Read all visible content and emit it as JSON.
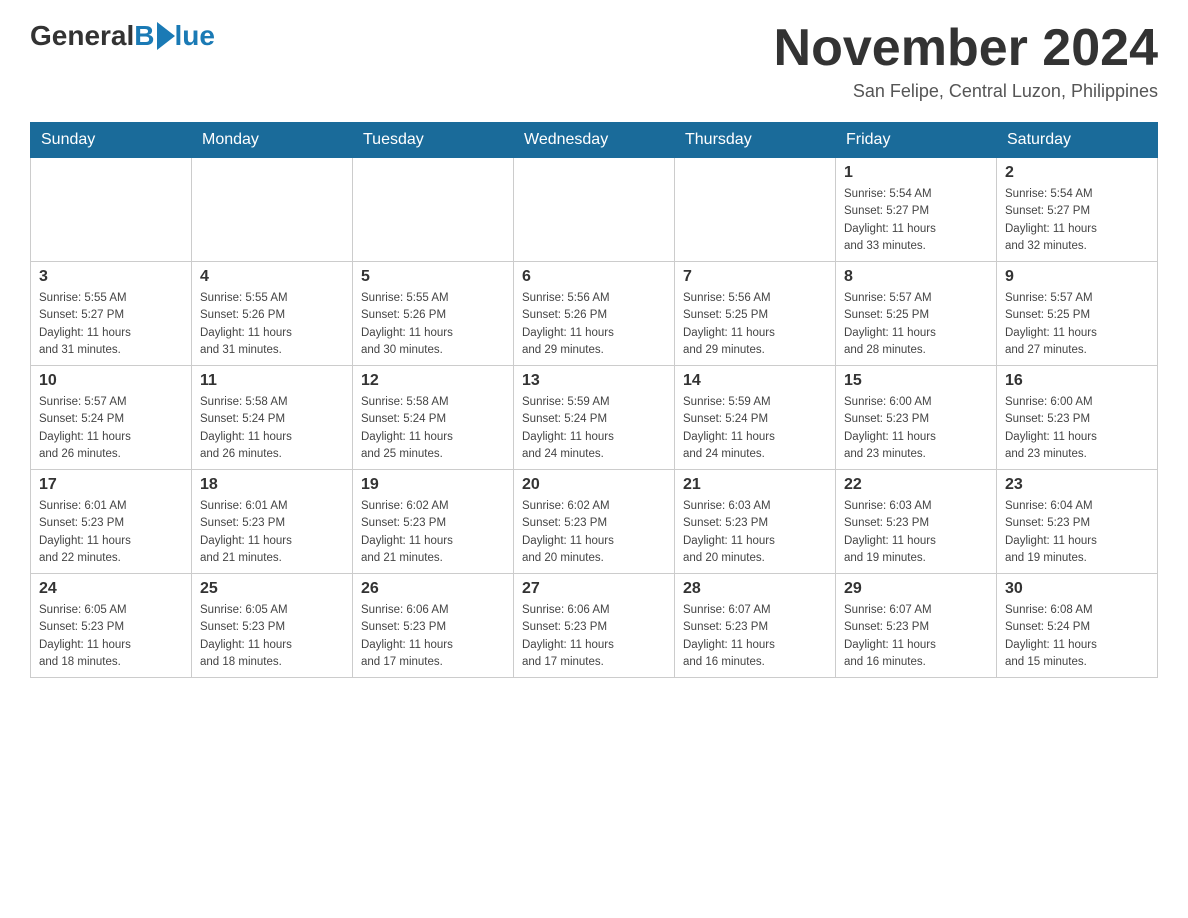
{
  "header": {
    "logo": {
      "general": "General",
      "blue": "Blue"
    },
    "title": "November 2024",
    "location": "San Felipe, Central Luzon, Philippines"
  },
  "weekdays": [
    "Sunday",
    "Monday",
    "Tuesday",
    "Wednesday",
    "Thursday",
    "Friday",
    "Saturday"
  ],
  "weeks": [
    [
      {
        "day": "",
        "info": ""
      },
      {
        "day": "",
        "info": ""
      },
      {
        "day": "",
        "info": ""
      },
      {
        "day": "",
        "info": ""
      },
      {
        "day": "",
        "info": ""
      },
      {
        "day": "1",
        "info": "Sunrise: 5:54 AM\nSunset: 5:27 PM\nDaylight: 11 hours\nand 33 minutes."
      },
      {
        "day": "2",
        "info": "Sunrise: 5:54 AM\nSunset: 5:27 PM\nDaylight: 11 hours\nand 32 minutes."
      }
    ],
    [
      {
        "day": "3",
        "info": "Sunrise: 5:55 AM\nSunset: 5:27 PM\nDaylight: 11 hours\nand 31 minutes."
      },
      {
        "day": "4",
        "info": "Sunrise: 5:55 AM\nSunset: 5:26 PM\nDaylight: 11 hours\nand 31 minutes."
      },
      {
        "day": "5",
        "info": "Sunrise: 5:55 AM\nSunset: 5:26 PM\nDaylight: 11 hours\nand 30 minutes."
      },
      {
        "day": "6",
        "info": "Sunrise: 5:56 AM\nSunset: 5:26 PM\nDaylight: 11 hours\nand 29 minutes."
      },
      {
        "day": "7",
        "info": "Sunrise: 5:56 AM\nSunset: 5:25 PM\nDaylight: 11 hours\nand 29 minutes."
      },
      {
        "day": "8",
        "info": "Sunrise: 5:57 AM\nSunset: 5:25 PM\nDaylight: 11 hours\nand 28 minutes."
      },
      {
        "day": "9",
        "info": "Sunrise: 5:57 AM\nSunset: 5:25 PM\nDaylight: 11 hours\nand 27 minutes."
      }
    ],
    [
      {
        "day": "10",
        "info": "Sunrise: 5:57 AM\nSunset: 5:24 PM\nDaylight: 11 hours\nand 26 minutes."
      },
      {
        "day": "11",
        "info": "Sunrise: 5:58 AM\nSunset: 5:24 PM\nDaylight: 11 hours\nand 26 minutes."
      },
      {
        "day": "12",
        "info": "Sunrise: 5:58 AM\nSunset: 5:24 PM\nDaylight: 11 hours\nand 25 minutes."
      },
      {
        "day": "13",
        "info": "Sunrise: 5:59 AM\nSunset: 5:24 PM\nDaylight: 11 hours\nand 24 minutes."
      },
      {
        "day": "14",
        "info": "Sunrise: 5:59 AM\nSunset: 5:24 PM\nDaylight: 11 hours\nand 24 minutes."
      },
      {
        "day": "15",
        "info": "Sunrise: 6:00 AM\nSunset: 5:23 PM\nDaylight: 11 hours\nand 23 minutes."
      },
      {
        "day": "16",
        "info": "Sunrise: 6:00 AM\nSunset: 5:23 PM\nDaylight: 11 hours\nand 23 minutes."
      }
    ],
    [
      {
        "day": "17",
        "info": "Sunrise: 6:01 AM\nSunset: 5:23 PM\nDaylight: 11 hours\nand 22 minutes."
      },
      {
        "day": "18",
        "info": "Sunrise: 6:01 AM\nSunset: 5:23 PM\nDaylight: 11 hours\nand 21 minutes."
      },
      {
        "day": "19",
        "info": "Sunrise: 6:02 AM\nSunset: 5:23 PM\nDaylight: 11 hours\nand 21 minutes."
      },
      {
        "day": "20",
        "info": "Sunrise: 6:02 AM\nSunset: 5:23 PM\nDaylight: 11 hours\nand 20 minutes."
      },
      {
        "day": "21",
        "info": "Sunrise: 6:03 AM\nSunset: 5:23 PM\nDaylight: 11 hours\nand 20 minutes."
      },
      {
        "day": "22",
        "info": "Sunrise: 6:03 AM\nSunset: 5:23 PM\nDaylight: 11 hours\nand 19 minutes."
      },
      {
        "day": "23",
        "info": "Sunrise: 6:04 AM\nSunset: 5:23 PM\nDaylight: 11 hours\nand 19 minutes."
      }
    ],
    [
      {
        "day": "24",
        "info": "Sunrise: 6:05 AM\nSunset: 5:23 PM\nDaylight: 11 hours\nand 18 minutes."
      },
      {
        "day": "25",
        "info": "Sunrise: 6:05 AM\nSunset: 5:23 PM\nDaylight: 11 hours\nand 18 minutes."
      },
      {
        "day": "26",
        "info": "Sunrise: 6:06 AM\nSunset: 5:23 PM\nDaylight: 11 hours\nand 17 minutes."
      },
      {
        "day": "27",
        "info": "Sunrise: 6:06 AM\nSunset: 5:23 PM\nDaylight: 11 hours\nand 17 minutes."
      },
      {
        "day": "28",
        "info": "Sunrise: 6:07 AM\nSunset: 5:23 PM\nDaylight: 11 hours\nand 16 minutes."
      },
      {
        "day": "29",
        "info": "Sunrise: 6:07 AM\nSunset: 5:23 PM\nDaylight: 11 hours\nand 16 minutes."
      },
      {
        "day": "30",
        "info": "Sunrise: 6:08 AM\nSunset: 5:24 PM\nDaylight: 11 hours\nand 15 minutes."
      }
    ]
  ]
}
